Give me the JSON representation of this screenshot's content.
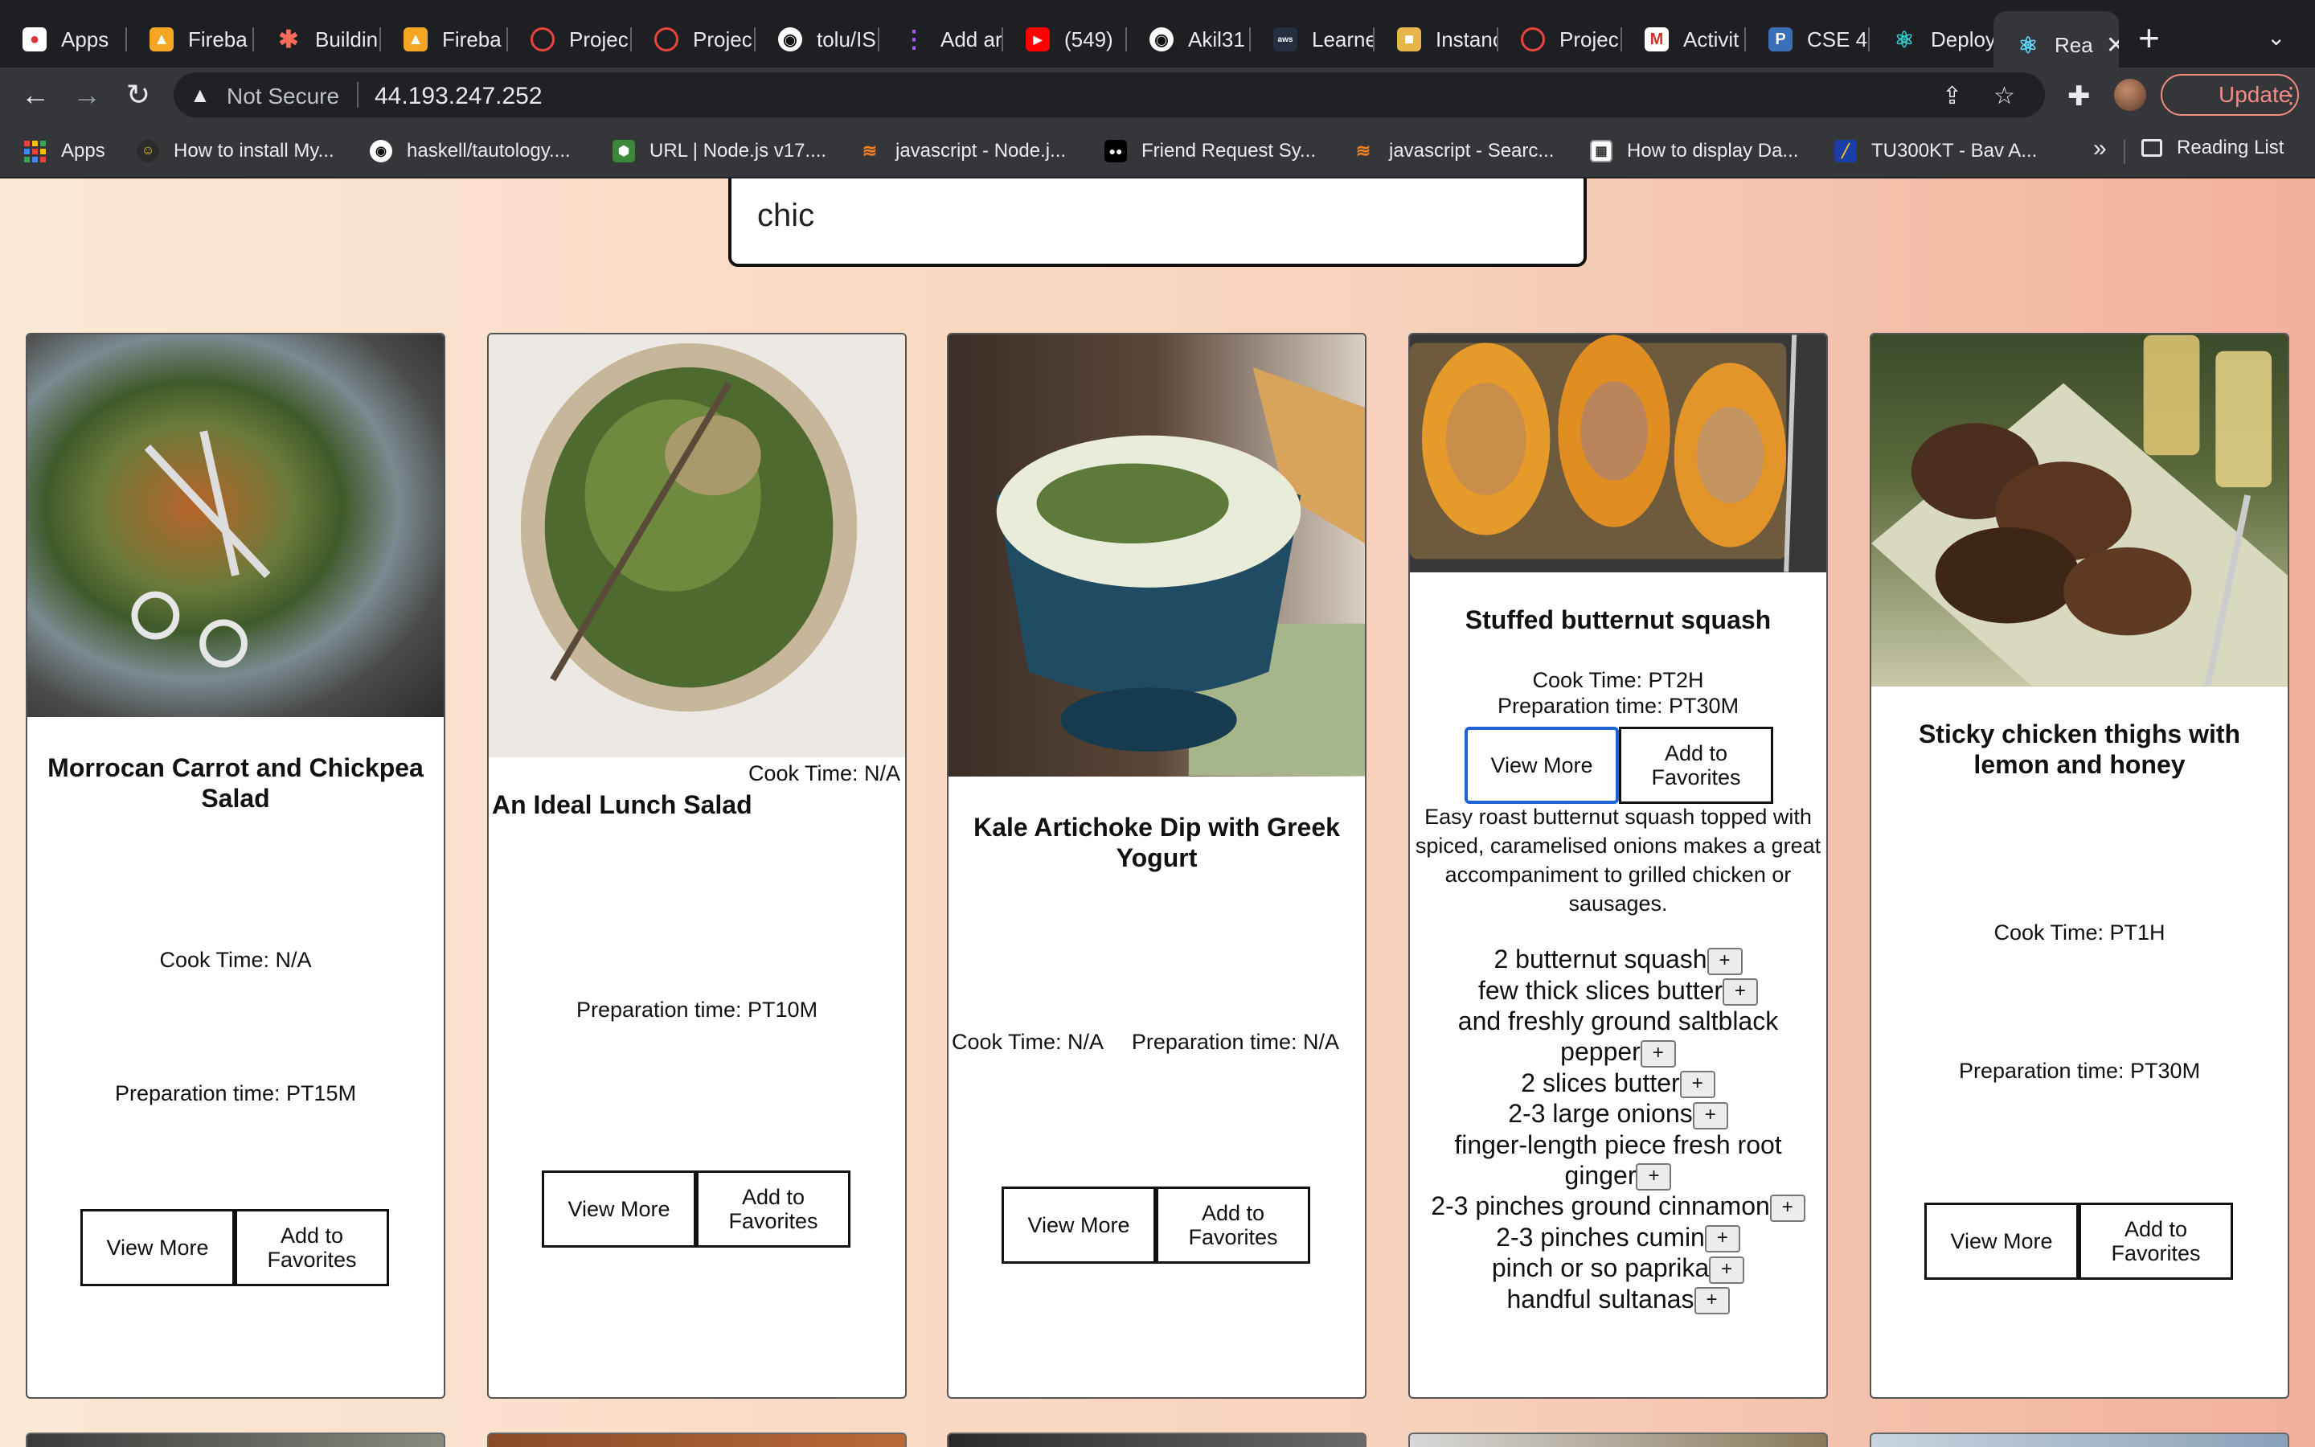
{
  "browser": {
    "tabs": [
      {
        "label": "Apps",
        "favicon": "apps-icon"
      },
      {
        "label": "Fireba",
        "favicon": "firebase-icon"
      },
      {
        "label": "Buildin",
        "favicon": "asterisk-icon"
      },
      {
        "label": "Fireba",
        "favicon": "firebase-icon"
      },
      {
        "label": "Projec",
        "favicon": "project-icon"
      },
      {
        "label": "Projec",
        "favicon": "project-icon"
      },
      {
        "label": "tolu/IS",
        "favicon": "github-icon"
      },
      {
        "label": "Add ar",
        "favicon": "bar-icon"
      },
      {
        "label": "(549)",
        "favicon": "youtube-icon"
      },
      {
        "label": "Akil31",
        "favicon": "github-icon"
      },
      {
        "label": "Learne",
        "favicon": "aws-icon"
      },
      {
        "label": "Instanc",
        "favicon": "box-icon"
      },
      {
        "label": "Projec",
        "favicon": "project-icon"
      },
      {
        "label": "Activit",
        "favicon": "gmail-icon"
      },
      {
        "label": "CSE 4",
        "favicon": "p-icon"
      },
      {
        "label": "Deploy",
        "favicon": "react-icon"
      },
      {
        "label": "Rea",
        "favicon": "react-icon"
      }
    ],
    "new_tab": "+",
    "address": {
      "security": "Not Secure",
      "url": "44.193.247.252"
    },
    "update_label": "Update",
    "bookmarks": [
      {
        "label": "Apps",
        "icon": "apps-grid-icon"
      },
      {
        "label": "How to install My...",
        "icon": "tutorial-icon"
      },
      {
        "label": "haskell/tautology....",
        "icon": "github-icon"
      },
      {
        "label": "URL | Node.js v17....",
        "icon": "nodejs-icon"
      },
      {
        "label": "javascript - Node.j...",
        "icon": "stackoverflow-icon"
      },
      {
        "label": "Friend Request Sy...",
        "icon": "medium-icon"
      },
      {
        "label": "javascript - Searc...",
        "icon": "stackoverflow-icon"
      },
      {
        "label": "How to display Da...",
        "icon": "doc-icon"
      },
      {
        "label": "TU300KT - Bav A...",
        "icon": "bav-icon"
      }
    ],
    "bookmarks_more": "»",
    "reading_list": "Reading List"
  },
  "search": {
    "value": "chic"
  },
  "recipes": [
    {
      "title": "Morrocan Carrot and Chickpea Salad",
      "cook_time": "Cook Time: N/A",
      "prep_time": "Preparation time: PT15M",
      "view_more": "View More",
      "add_fav": "Add to Favorites"
    },
    {
      "title": "An Ideal Lunch Salad",
      "cook_time": "Cook Time: N/A",
      "prep_time": "Preparation time: PT10M",
      "view_more": "View More",
      "add_fav": "Add to Favorites"
    },
    {
      "title": "Kale Artichoke Dip with Greek Yogurt",
      "cook_time": "Cook Time: N/A",
      "prep_time": "Preparation time: N/A",
      "view_more": "View More",
      "add_fav": "Add to Favorites"
    },
    {
      "title": "Stuffed butternut squash",
      "cook_time": "Cook Time: PT2H",
      "prep_time": "Preparation time: PT30M",
      "view_more": "View More",
      "add_fav": "Add to Favorites",
      "description": "Easy roast butternut squash topped with spiced, caramelised onions makes a great accompaniment to grilled chicken or sausages.",
      "ingredients": [
        "2 butternut squash",
        "few thick slices butter",
        "and freshly ground saltblack pepper",
        "2 slices butter",
        "2-3 large onions",
        "finger-length piece fresh root ginger",
        "2-3 pinches ground cinnamon",
        "2-3 pinches cumin",
        "pinch or so paprika",
        "handful sultanas"
      ],
      "add_ingredient": "+"
    },
    {
      "title": "Sticky chicken thighs with lemon and honey",
      "cook_time": "Cook Time: PT1H",
      "prep_time": "Preparation time: PT30M",
      "view_more": "View More",
      "add_fav": "Add to Favorites"
    }
  ],
  "colors": {
    "page_gradient": [
      "#fbe8d6",
      "#f8d2bc",
      "#f1b19c"
    ],
    "focus_border": "#1e63d6"
  }
}
